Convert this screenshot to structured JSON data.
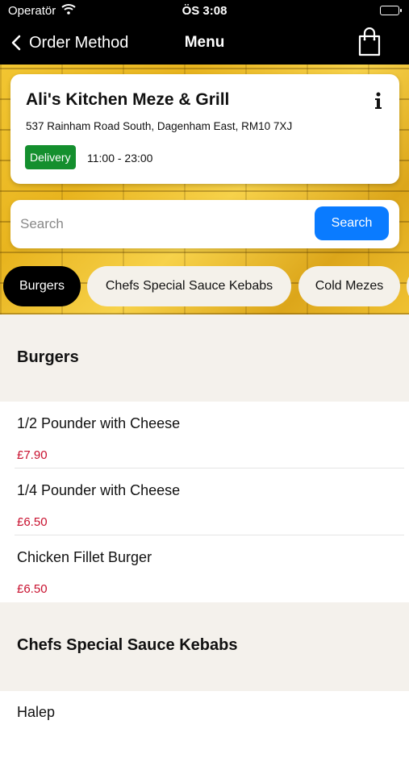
{
  "status": {
    "carrier": "Operatör",
    "time": "ÖS 3:08"
  },
  "nav": {
    "back_label": "Order Method",
    "title": "Menu"
  },
  "restaurant": {
    "name": "Ali's Kitchen Meze & Grill",
    "address": "537 Rainham Road South, Dagenham East, RM10 7XJ",
    "badge": "Delivery",
    "hours": "11:00 - 23:00"
  },
  "search": {
    "placeholder": "Search",
    "value": "",
    "button": "Search"
  },
  "categories": [
    "Burgers",
    "Chefs Special Sauce Kebabs",
    "Cold Mezes"
  ],
  "sections": [
    {
      "title": "Burgers",
      "items": [
        {
          "name": "1/2 Pounder with Cheese",
          "price": "£7.90"
        },
        {
          "name": "1/4 Pounder with Cheese",
          "price": "£6.50"
        },
        {
          "name": "Chicken Fillet Burger",
          "price": "£6.50"
        }
      ]
    },
    {
      "title": "Chefs Special Sauce Kebabs",
      "items": [
        {
          "name": "Halep",
          "price": ""
        }
      ]
    }
  ],
  "colors": {
    "accent": "#0a7bff",
    "price": "#c8102e",
    "badge": "#148f2e"
  }
}
